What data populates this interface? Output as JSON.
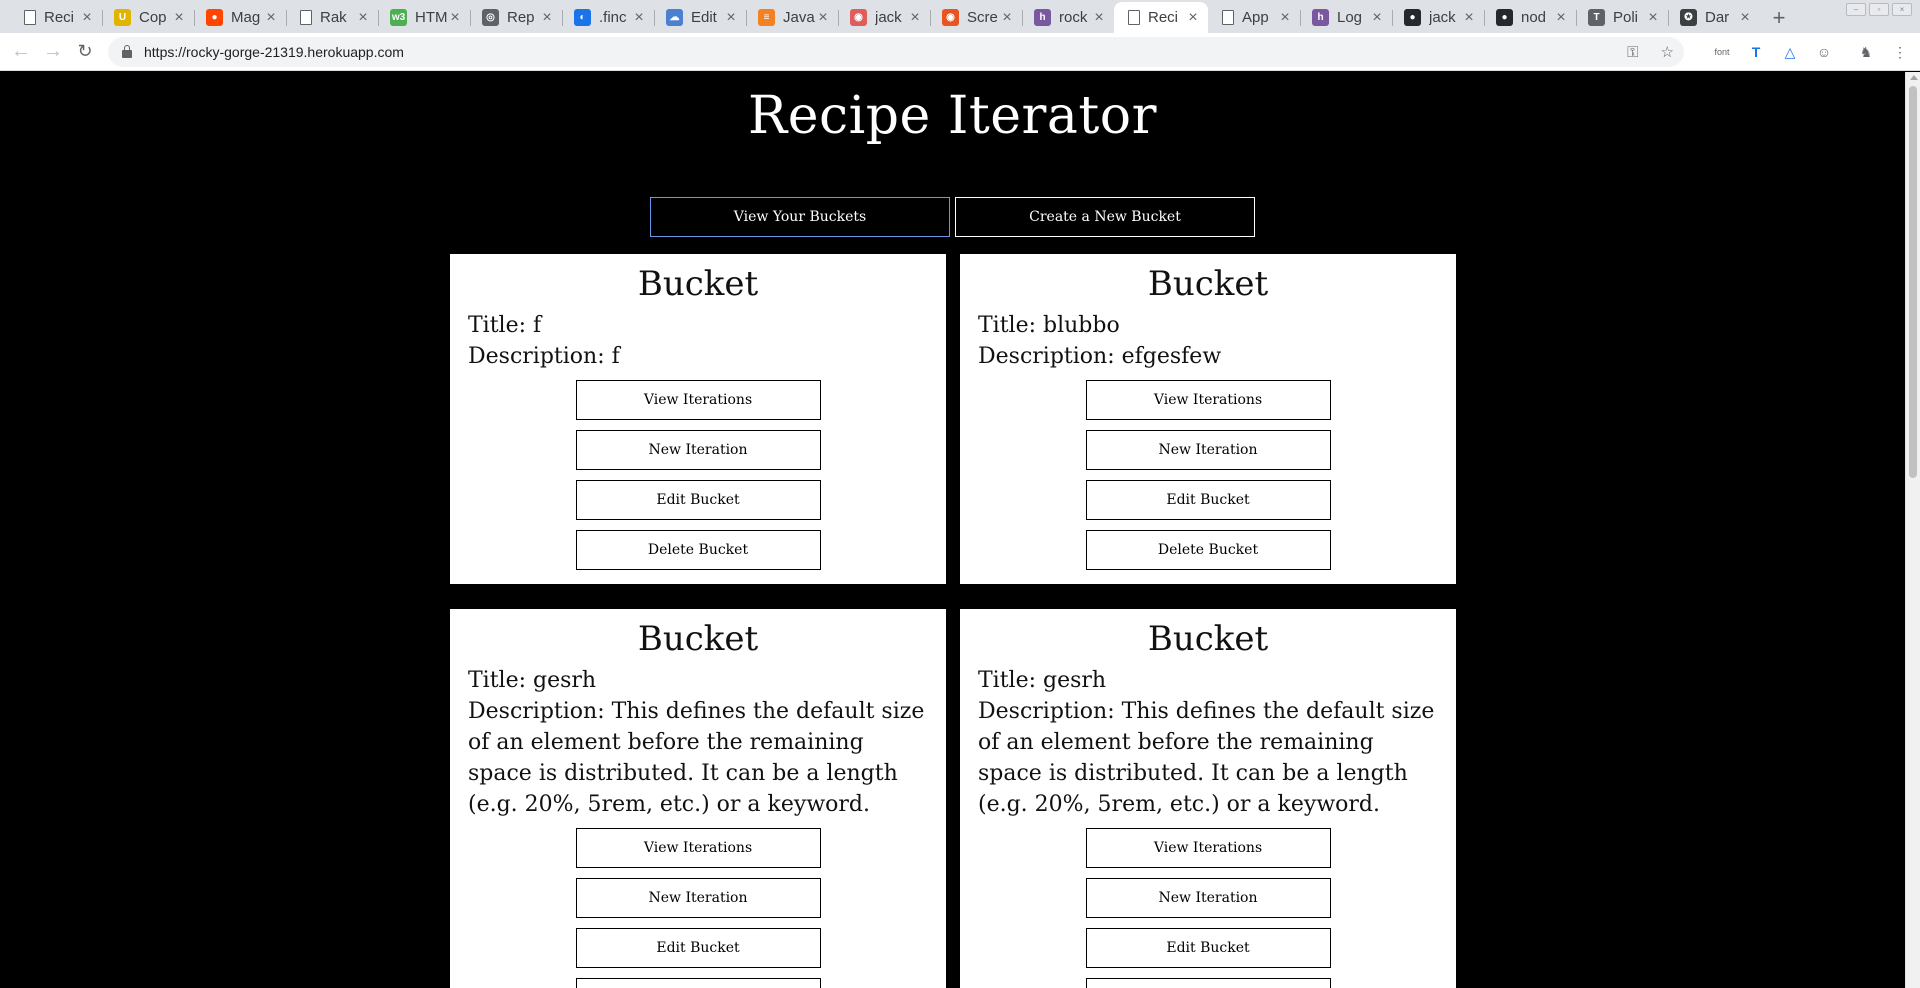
{
  "browser": {
    "tabs": [
      {
        "label": "Reci",
        "icon": "document-icon"
      },
      {
        "label": "Cop",
        "icon": "udemy-icon",
        "color": "#e0b400"
      },
      {
        "label": "Mag",
        "icon": "reddit-icon",
        "color": "#ff4500"
      },
      {
        "label": "Rak",
        "icon": "document-icon"
      },
      {
        "label": "HTM",
        "icon": "w3schools-icon",
        "color": "#4caf50"
      },
      {
        "label": "Rep",
        "icon": "repl-icon",
        "color": "#5f6368"
      },
      {
        "label": ".finc",
        "icon": "docs-icon",
        "color": "#1a73e8"
      },
      {
        "label": "Edit",
        "icon": "cloud-icon",
        "color": "#4a7fd1"
      },
      {
        "label": "Java",
        "icon": "stackoverflow-icon",
        "color": "#f48024"
      },
      {
        "label": "jack",
        "icon": "npm-icon",
        "color": "#e05d5d"
      },
      {
        "label": "Scre",
        "icon": "ubuntu-icon",
        "color": "#e95420"
      },
      {
        "label": "rock",
        "icon": "heroku-icon",
        "color": "#79589f"
      },
      {
        "label": "Reci",
        "icon": "document-icon",
        "active": true
      },
      {
        "label": "App",
        "icon": "document-icon"
      },
      {
        "label": "Log",
        "icon": "heroku-icon",
        "color": "#79589f"
      },
      {
        "label": "jack",
        "icon": "github-icon",
        "color": "#24292e"
      },
      {
        "label": "nod",
        "icon": "github-icon",
        "color": "#24292e"
      },
      {
        "label": "Poli",
        "icon": "typora-icon",
        "color": "#5f6368"
      },
      {
        "label": "Dar",
        "icon": "dark-reader-icon",
        "color": "#3c4043"
      }
    ],
    "url": "https://rocky-gorge-21319.herokuapp.com"
  },
  "page": {
    "title": "Recipe Iterator",
    "nav": {
      "view_buckets": "View Your Buckets",
      "create_bucket": "Create a New Bucket"
    },
    "buckets": [
      {
        "heading": "Bucket",
        "title": "Title: f",
        "description": "Description: f"
      },
      {
        "heading": "Bucket",
        "title": "Title: blubbo",
        "description": "Description: efgesfew"
      },
      {
        "heading": "Bucket",
        "title": "Title: gesrh",
        "description": "Description: This defines the default size of an element before the remaining space is distributed. It can be a length (e.g. 20%, 5rem, etc.) or a keyword."
      },
      {
        "heading": "Bucket",
        "title": "Title: gesrh",
        "description": "Description: This defines the default size of an element before the remaining space is distributed. It can be a length (e.g. 20%, 5rem, etc.) or a keyword."
      }
    ],
    "card_actions": {
      "view_iterations": "View Iterations",
      "new_iteration": "New Iteration",
      "edit_bucket": "Edit Bucket",
      "delete_bucket": "Delete Bucket"
    }
  }
}
